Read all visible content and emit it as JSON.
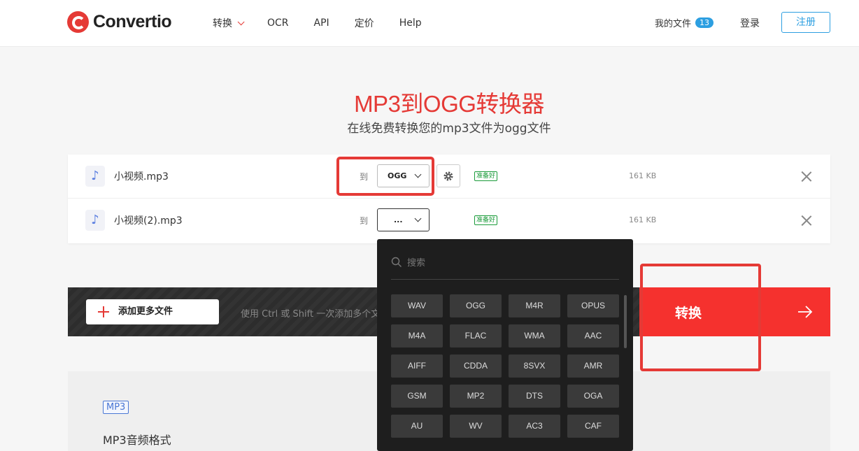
{
  "header": {
    "brand": "Convertio",
    "nav": [
      {
        "label": "转换",
        "has_dropdown": true
      },
      {
        "label": "OCR"
      },
      {
        "label": "API"
      },
      {
        "label": "定价"
      },
      {
        "label": "Help"
      }
    ],
    "my_files_label": "我的文件",
    "my_files_count": "13",
    "login": "登录",
    "signup": "注册"
  },
  "hero": {
    "title": "MP3到OGG转换器",
    "subtitle": "在线免费转换您的mp3文件为ogg文件"
  },
  "files": [
    {
      "name": "小视频.mp3",
      "to_label": "到",
      "format": "OGG",
      "status": "准备好",
      "size": "161 KB",
      "icon": "music-note-icon"
    },
    {
      "name": "小视频(2).mp3",
      "to_label": "到",
      "format": "...",
      "status": "准备好",
      "size": "161 KB",
      "icon": "music-note-icon"
    }
  ],
  "actions": {
    "add_more": "添加更多文件",
    "hint": "使用 Ctrl 或 Shift 一次添加多个文件",
    "convert": "转换"
  },
  "dropdown": {
    "search_placeholder": "搜索",
    "formats": [
      "WAV",
      "OGG",
      "M4R",
      "OPUS",
      "M4A",
      "FLAC",
      "WMA",
      "AAC",
      "AIFF",
      "CDDA",
      "8SVX",
      "AMR",
      "GSM",
      "MP2",
      "DTS",
      "OGA",
      "AU",
      "WV",
      "AC3",
      "CAF"
    ]
  },
  "info": {
    "badge": "MP3",
    "title": "MP3音频格式"
  },
  "colors": {
    "brand_red": "#e53a36",
    "convert_red": "#f5312e",
    "link_blue": "#2d9fe1",
    "ready_green": "#1a9b3a"
  }
}
